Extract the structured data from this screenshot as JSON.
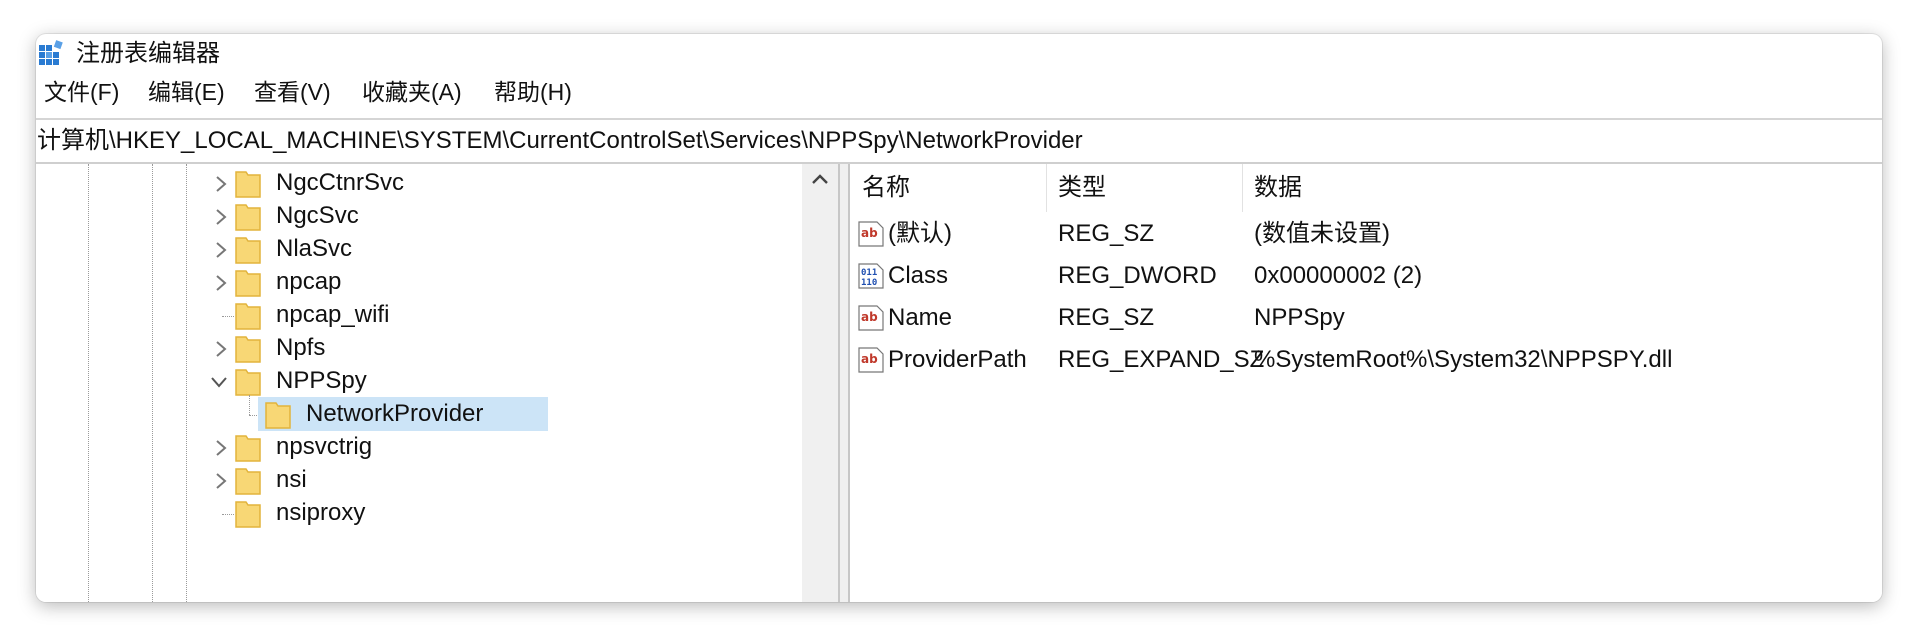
{
  "window": {
    "title": "注册表编辑器"
  },
  "menu": [
    {
      "label": "文件(F)"
    },
    {
      "label": "编辑(E)"
    },
    {
      "label": "查看(V)"
    },
    {
      "label": "收藏夹(A)"
    },
    {
      "label": "帮助(H)"
    }
  ],
  "address": {
    "path": "计算机\\HKEY_LOCAL_MACHINE\\SYSTEM\\CurrentControlSet\\Services\\NPPSpy\\NetworkProvider"
  },
  "tree": {
    "items": [
      {
        "label": "NgcCtnrSvc",
        "expander": "collapsed"
      },
      {
        "label": "NgcSvc",
        "expander": "collapsed"
      },
      {
        "label": "NlaSvc",
        "expander": "collapsed"
      },
      {
        "label": "npcap",
        "expander": "collapsed"
      },
      {
        "label": "npcap_wifi",
        "expander": "none"
      },
      {
        "label": "Npfs",
        "expander": "collapsed"
      },
      {
        "label": "NPPSpy",
        "expander": "expanded"
      },
      {
        "label": "NetworkProvider",
        "expander": "none",
        "selected": true,
        "child": true
      },
      {
        "label": "npsvctrig",
        "expander": "collapsed"
      },
      {
        "label": "nsi",
        "expander": "collapsed"
      },
      {
        "label": "nsiproxy",
        "expander": "none"
      }
    ]
  },
  "list": {
    "columns": [
      {
        "label": "名称"
      },
      {
        "label": "类型"
      },
      {
        "label": "数据"
      }
    ],
    "rows": [
      {
        "icon": "string-value-icon",
        "name": "(默认)",
        "type": "REG_SZ",
        "data": "(数值未设置)"
      },
      {
        "icon": "binary-value-icon",
        "name": "Class",
        "type": "REG_DWORD",
        "data": "0x00000002 (2)"
      },
      {
        "icon": "string-value-icon",
        "name": "Name",
        "type": "REG_SZ",
        "data": "NPPSpy"
      },
      {
        "icon": "string-value-icon",
        "name": "ProviderPath",
        "type": "REG_EXPAND_SZ",
        "data": "%SystemRoot%\\System32\\NPPSPY.dll"
      }
    ]
  },
  "colors": {
    "selection": "#cce4f7",
    "folder": "#f8d775",
    "folderEdge": "#e2b43c",
    "accent": "#1a73c9"
  }
}
